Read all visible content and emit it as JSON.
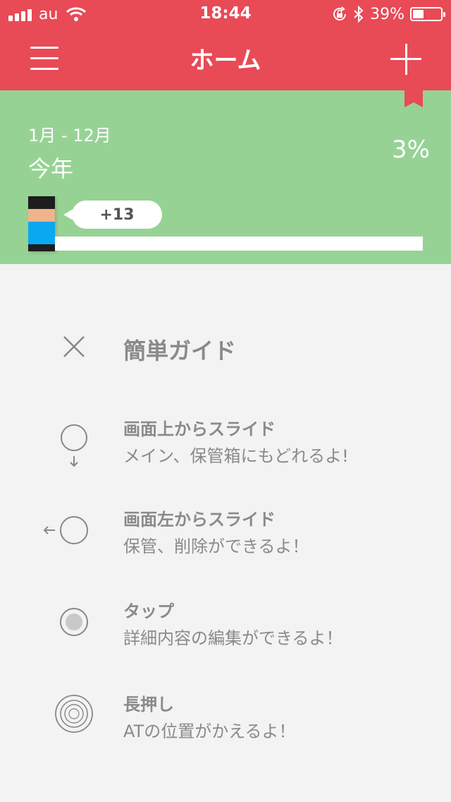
{
  "status_bar": {
    "carrier": "au",
    "time": "18:44",
    "battery_text": "39%",
    "battery_level": 0.39,
    "icons": [
      "signal-icon",
      "wifi-icon",
      "orientation-lock-icon",
      "bluetooth-icon",
      "battery-icon"
    ]
  },
  "header": {
    "title": "ホーム",
    "background": "#e84a56",
    "menu_icon": "hamburger-menu-icon",
    "add_icon": "plus-icon",
    "bookmark_icon": "bookmark-ribbon-icon"
  },
  "progress_panel": {
    "range": "1月 - 12月",
    "period": "今年",
    "percent": "3%",
    "progress": 0.03,
    "bubble": "+13",
    "background": "#97d295"
  },
  "guide": {
    "title": "簡単ガイド",
    "close_icon": "close-x-icon",
    "items": [
      {
        "icon": "swipe-down-circle-icon",
        "heading": "画面上からスライド",
        "description": "メイン、保管箱にもどれるよ!"
      },
      {
        "icon": "swipe-left-circle-icon",
        "heading": "画面左からスライド",
        "description": "保管、削除ができるよ！"
      },
      {
        "icon": "tap-circle-icon",
        "heading": "タップ",
        "description": "詳細内容の編集ができるよ！"
      },
      {
        "icon": "long-press-ripple-icon",
        "heading": "長押し",
        "description": "ATの位置がかえるよ！"
      }
    ]
  }
}
